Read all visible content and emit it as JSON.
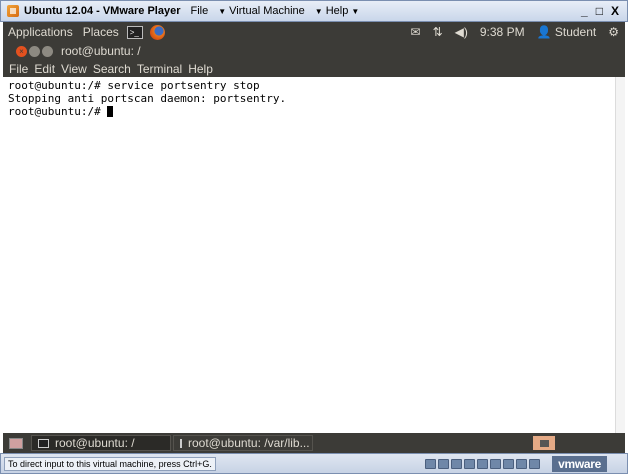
{
  "vm_window": {
    "title": "Ubuntu 12.04 - VMware Player",
    "menus": [
      {
        "label": "File"
      },
      {
        "label": "Virtual Machine"
      },
      {
        "label": "Help"
      }
    ],
    "controls": {
      "minimize": "_",
      "maximize": "□",
      "close": "X"
    }
  },
  "ubuntu_panel": {
    "applications": "Applications",
    "places": "Places",
    "mail_icon": "mail-icon",
    "network_icon": "network-icon",
    "volume_icon": "volume-icon",
    "clock": "9:38 PM",
    "user": "Student",
    "settings_icon": "gear-icon"
  },
  "terminal_window": {
    "title": "root@ubuntu: /",
    "menu": [
      "File",
      "Edit",
      "View",
      "Search",
      "Terminal",
      "Help"
    ],
    "lines": [
      "root@ubuntu:/# service portsentry stop",
      "Stopping anti portscan daemon: portsentry.",
      "root@ubuntu:/# "
    ]
  },
  "taskbar": {
    "tasks": [
      {
        "label": "root@ubuntu: /"
      },
      {
        "label": "root@ubuntu: /var/lib..."
      }
    ]
  },
  "statusbar": {
    "hint": "To direct input to this virtual machine, press Ctrl+G.",
    "brand": "vmware"
  }
}
